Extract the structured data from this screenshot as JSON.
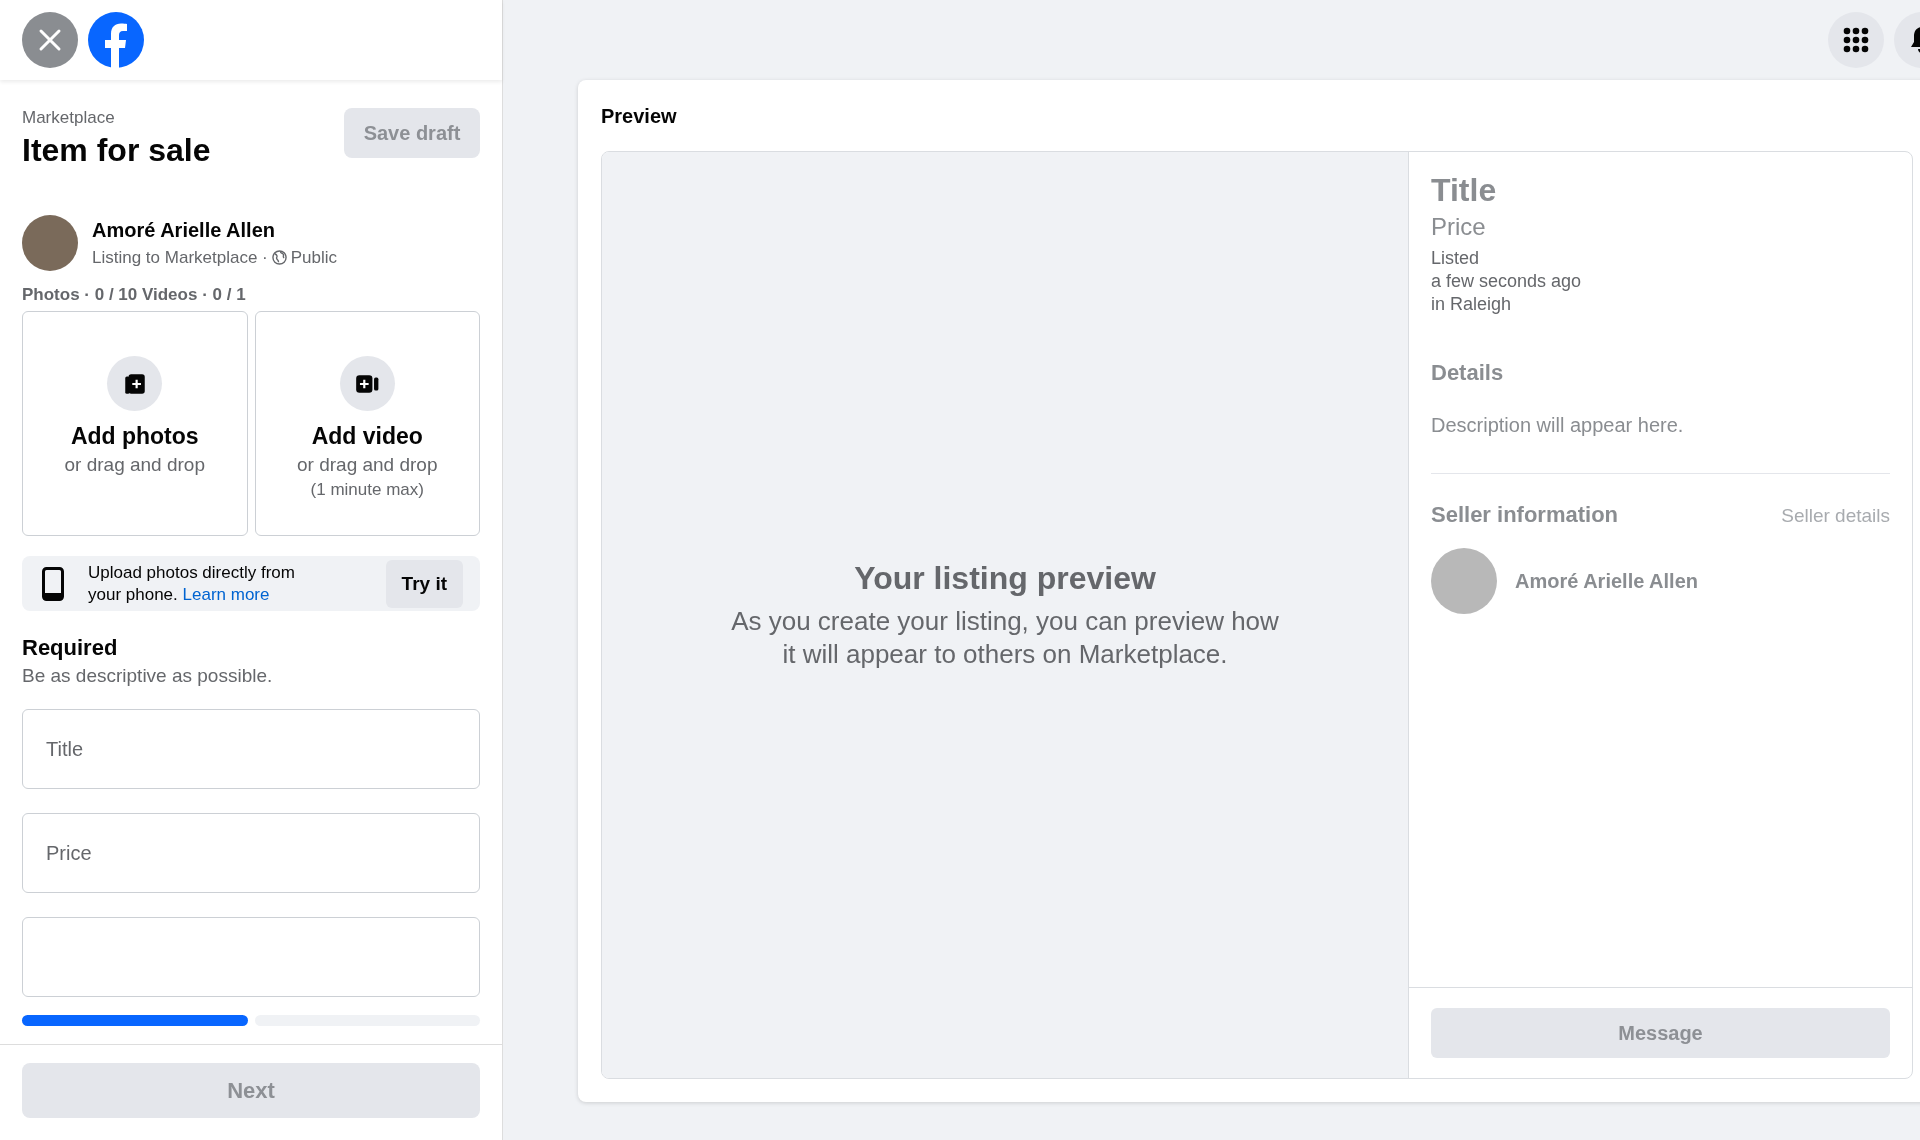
{
  "composer": {
    "breadcrumb": "Marketplace",
    "title": "Item for sale",
    "save_draft": {
      "label": "Save draft",
      "disabled": true
    },
    "seller": {
      "name": "Amoré Arielle Allen",
      "subtitle": "Listing to Marketplace ·",
      "audience": "Public"
    },
    "media_count": "Photos · 0 / 10 Videos · 0 / 1",
    "upload_tiles": [
      {
        "kind": "photos",
        "title": "Add photos",
        "lines": [
          "or drag and drop"
        ]
      },
      {
        "kind": "video",
        "title": "Add video",
        "lines": [
          "or drag and drop",
          "(1 minute max)"
        ]
      }
    ],
    "phone_banner": {
      "text": "Upload photos directly from your phone.",
      "link": "Learn more",
      "button": "Try it"
    },
    "section": {
      "title": "Required",
      "subtitle": "Be as descriptive as possible."
    },
    "fields": [
      {
        "kind": "text",
        "placeholder": "Title"
      },
      {
        "kind": "text",
        "placeholder": "Price"
      },
      {
        "kind": "text"
      }
    ],
    "progress": [
      {
        "complete": true
      },
      {
        "complete": false
      }
    ],
    "next": {
      "label": "Next",
      "disabled": true
    }
  },
  "preview": {
    "heading": "Preview",
    "empty_title": "Your listing preview",
    "empty_text": "As you create your listing, you can preview how it will appear to others on Marketplace.",
    "listing": {
      "title": "Title",
      "price": "Price",
      "listed": [
        "Listed",
        "a few seconds ago",
        "in Raleigh"
      ]
    },
    "details": {
      "heading": "Details",
      "description": "Description will appear here."
    },
    "seller": {
      "heading": "Seller information",
      "link": "Seller details",
      "name": "Amoré Arielle Allen"
    },
    "message": {
      "label": "Message",
      "disabled": true
    }
  }
}
